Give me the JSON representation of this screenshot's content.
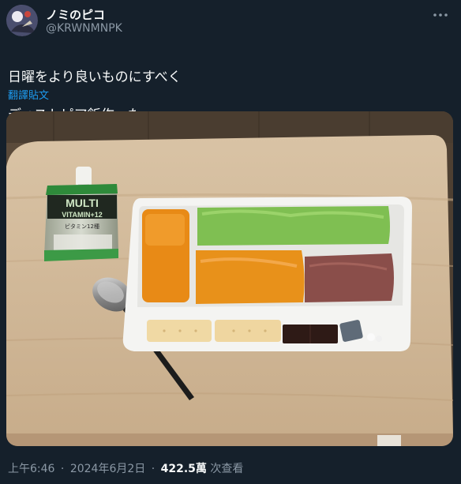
{
  "author": {
    "display_name": "ノミのピコ",
    "handle": "@KRWNMNPK"
  },
  "tweet": {
    "text_line1": "日曜をより良いものにすべく",
    "text_line2": "ディストピア飯作った。",
    "translate_label": "翻譯貼文"
  },
  "photo": {
    "pouch_brand": "MULTI",
    "pouch_sub": "VITAMIN+12",
    "pouch_jp": "ビタミン12種"
  },
  "footer": {
    "time": "上午6:46",
    "separator": "·",
    "date": "2024年6月2日",
    "views_count": "422.5萬",
    "views_label": "次查看"
  },
  "colors": {
    "background": "#15202b",
    "link": "#1d9bf0",
    "muted": "#8b98a5"
  }
}
